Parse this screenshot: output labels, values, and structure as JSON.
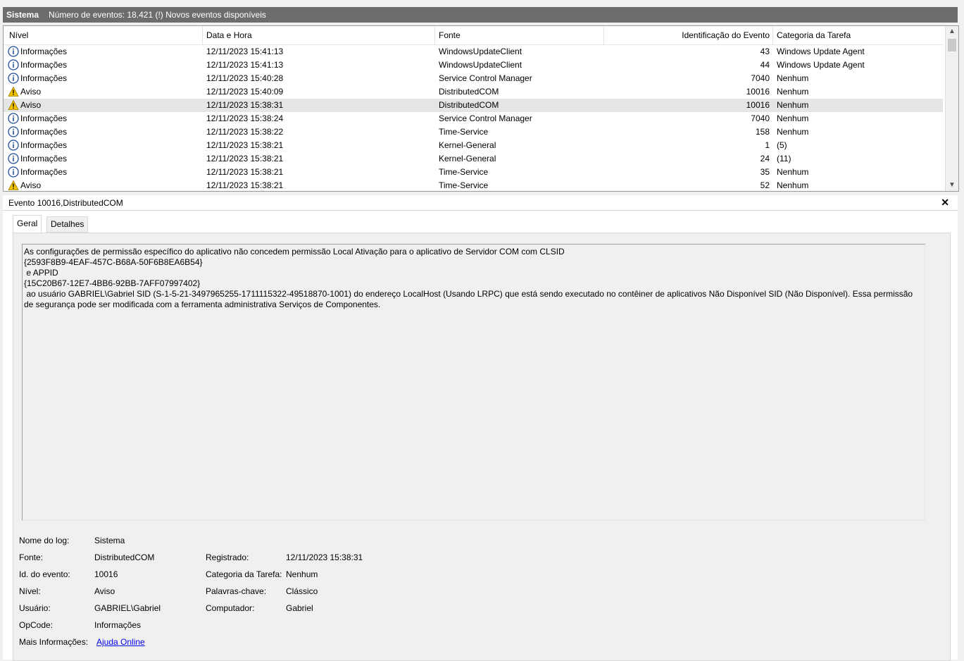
{
  "header": {
    "log_name": "Sistema",
    "summary": "Número de eventos: 18.421 (!) Novos eventos disponíveis"
  },
  "columns": {
    "level": "Nível",
    "datetime": "Data e Hora",
    "source": "Fonte",
    "event_id": "Identificação do Evento",
    "task_category": "Categoria da Tarefa"
  },
  "events": [
    {
      "level": "Informações",
      "icon": "info-icon",
      "datetime": "12/11/2023 15:41:13",
      "source": "WindowsUpdateClient",
      "event_id": "43",
      "category": "Windows Update Agent"
    },
    {
      "level": "Informações",
      "icon": "info-icon",
      "datetime": "12/11/2023 15:41:13",
      "source": "WindowsUpdateClient",
      "event_id": "44",
      "category": "Windows Update Agent"
    },
    {
      "level": "Informações",
      "icon": "info-icon",
      "datetime": "12/11/2023 15:40:28",
      "source": "Service Control Manager",
      "event_id": "7040",
      "category": "Nenhum"
    },
    {
      "level": "Aviso",
      "icon": "warning-icon",
      "datetime": "12/11/2023 15:40:09",
      "source": "DistributedCOM",
      "event_id": "10016",
      "category": "Nenhum"
    },
    {
      "level": "Aviso",
      "icon": "warning-icon",
      "datetime": "12/11/2023 15:38:31",
      "source": "DistributedCOM",
      "event_id": "10016",
      "category": "Nenhum",
      "selected": true
    },
    {
      "level": "Informações",
      "icon": "info-icon",
      "datetime": "12/11/2023 15:38:24",
      "source": "Service Control Manager",
      "event_id": "7040",
      "category": "Nenhum"
    },
    {
      "level": "Informações",
      "icon": "info-icon",
      "datetime": "12/11/2023 15:38:22",
      "source": "Time-Service",
      "event_id": "158",
      "category": "Nenhum"
    },
    {
      "level": "Informações",
      "icon": "info-icon",
      "datetime": "12/11/2023 15:38:21",
      "source": "Kernel-General",
      "event_id": "1",
      "category": "(5)"
    },
    {
      "level": "Informações",
      "icon": "info-icon",
      "datetime": "12/11/2023 15:38:21",
      "source": "Kernel-General",
      "event_id": "24",
      "category": "(11)"
    },
    {
      "level": "Informações",
      "icon": "info-icon",
      "datetime": "12/11/2023 15:38:21",
      "source": "Time-Service",
      "event_id": "35",
      "category": "Nenhum"
    },
    {
      "level": "Aviso",
      "icon": "warning-icon",
      "datetime": "12/11/2023 15:38:21",
      "source": "Time-Service",
      "event_id": "52",
      "category": "Nenhum"
    }
  ],
  "detail": {
    "title": "Evento 10016,DistributedCOM",
    "tabs": [
      "Geral",
      "Detalhes"
    ],
    "message": "As configurações de permissão específico do aplicativo não concedem permissão Local Ativação para o aplicativo de Servidor COM com CLSID \n{2593F8B9-4EAF-457C-B68A-50F6B8EA6B54}\n e APPID \n{15C20B67-12E7-4BB6-92BB-7AFF07997402}\n ao usuário GABRIEL\\Gabriel SID (S-1-5-21-3497965255-1711115322-49518870-1001) do endereço LocalHost (Usando LRPC) que está sendo executado no contêiner de aplicativos Não Disponível SID (Não Disponível). Essa permissão de segurança pode ser modificada com a ferramenta administrativa Serviços de Componentes.",
    "props": {
      "log_name_label": "Nome do log:",
      "log_name": "Sistema",
      "source_label": "Fonte:",
      "source": "DistributedCOM",
      "logged_label": "Registrado:",
      "logged": "12/11/2023 15:38:31",
      "event_id_label": "Id. do evento:",
      "event_id": "10016",
      "task_label": "Categoria da Tarefa:",
      "task": "Nenhum",
      "level_label": "Nível:",
      "level": "Aviso",
      "keywords_label": "Palavras-chave:",
      "keywords": "Clássico",
      "user_label": "Usuário:",
      "user": "GABRIEL\\Gabriel",
      "computer_label": "Computador:",
      "computer": "Gabriel",
      "opcode_label": "OpCode:",
      "opcode": "Informações",
      "more_info_label": "Mais Informações:",
      "more_info_link": "Ajuda Online"
    }
  },
  "colors": {
    "header_bar": "#6d6d6d",
    "selected_row": "#e5e5e5",
    "info_icon": "#1f4e9c",
    "warning_icon": "#f5c400"
  }
}
